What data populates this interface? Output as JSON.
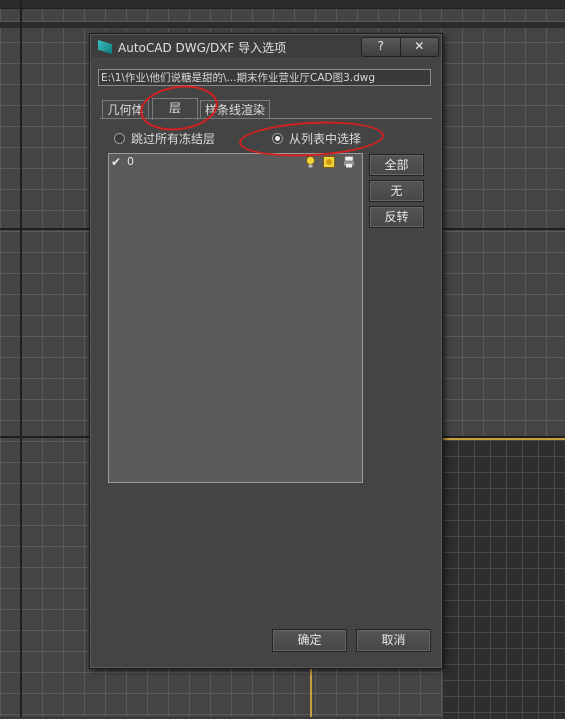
{
  "dialog": {
    "title": "AutoCAD DWG/DXF 导入选项",
    "help_label": "?",
    "close_label": "✕",
    "file_path": "E:\\1\\作业\\他们说糖是甜的\\...期末作业营业厅CAD图3.dwg"
  },
  "tabs": [
    {
      "label": "几何体",
      "active": false
    },
    {
      "label": "层",
      "active": true
    },
    {
      "label": "样条线渲染",
      "active": false
    }
  ],
  "options": {
    "skip_frozen_label": "跳过所有冻结层",
    "skip_frozen_selected": false,
    "select_from_list_label": "从列表中选择",
    "select_from_list_selected": true
  },
  "layers": [
    {
      "name": "0",
      "checked": true,
      "check_glyph": "✔",
      "icons": [
        "bulb-icon",
        "sun-icon",
        "printer-icon"
      ]
    }
  ],
  "side_buttons": {
    "all": "全部",
    "none": "无",
    "invert": "反转"
  },
  "footer": {
    "ok": "确定",
    "cancel": "取消"
  },
  "annotation_color": "#d42020"
}
